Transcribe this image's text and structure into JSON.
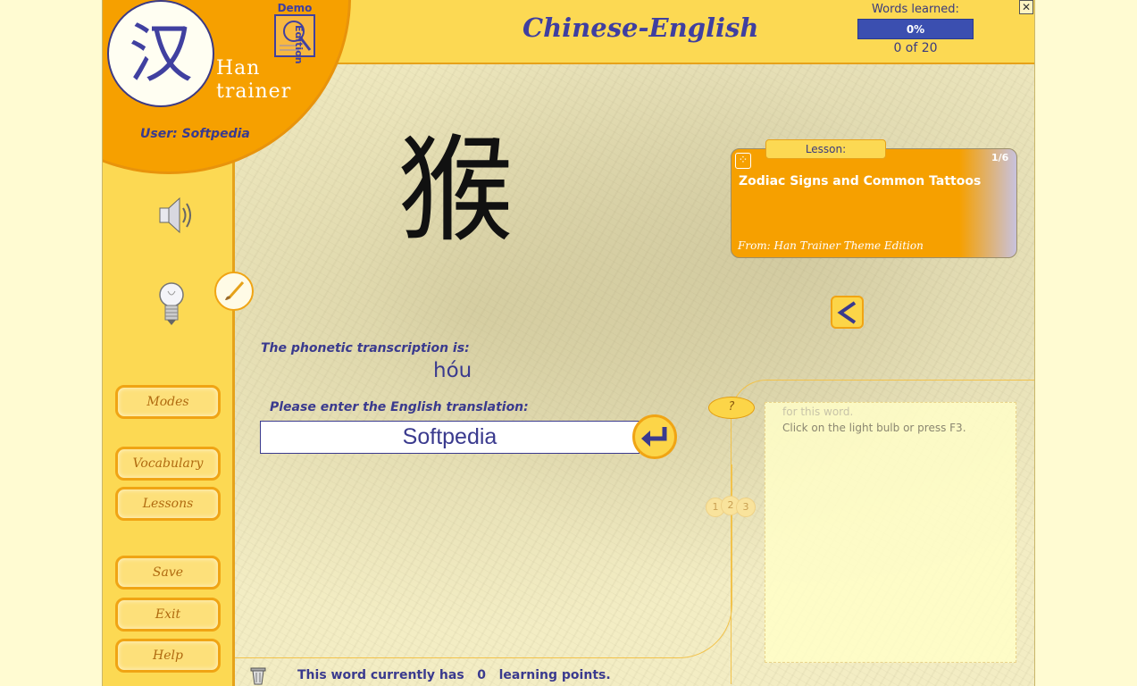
{
  "app": {
    "title": "Chinese-English",
    "logo_char": "汉",
    "logo_text_line1": "Han",
    "logo_text_line2": "trainer",
    "demo_label": "Demo",
    "edition_label": "Edition",
    "user_label": "User: Softpedia",
    "close_icon": "✕"
  },
  "progress": {
    "label": "Words learned:",
    "percent_text": "0%",
    "value": 0.0,
    "count_text": "0 of 20"
  },
  "sidebar": {
    "buttons": {
      "modes": "Modes",
      "vocabulary": "Vocabulary",
      "lessons": "Lessons",
      "save": "Save",
      "exit": "Exit",
      "help": "Help"
    }
  },
  "card": {
    "character": "猴",
    "phonetic_label": "The phonetic transcription is:",
    "phonetic_value": "hóu",
    "translation_label": "Please enter the English translation:",
    "translation_value": "Softpedia"
  },
  "lesson": {
    "tab_label": "Lesson:",
    "counter": "1/6",
    "name": "Zodiac Signs and Common Tattoos",
    "from": "From: Han Trainer Theme Edition"
  },
  "hint": {
    "button": "?",
    "line1": "for this word.",
    "line2": "Click on the light bulb or press F3.",
    "numbers": [
      "1",
      "2",
      "3"
    ]
  },
  "footer": {
    "points_text": "This word currently has   0   learning points."
  },
  "colors": {
    "accent_orange": "#f6a000",
    "panel_yellow": "#fcd953",
    "text_blue": "#3a3a8e"
  }
}
